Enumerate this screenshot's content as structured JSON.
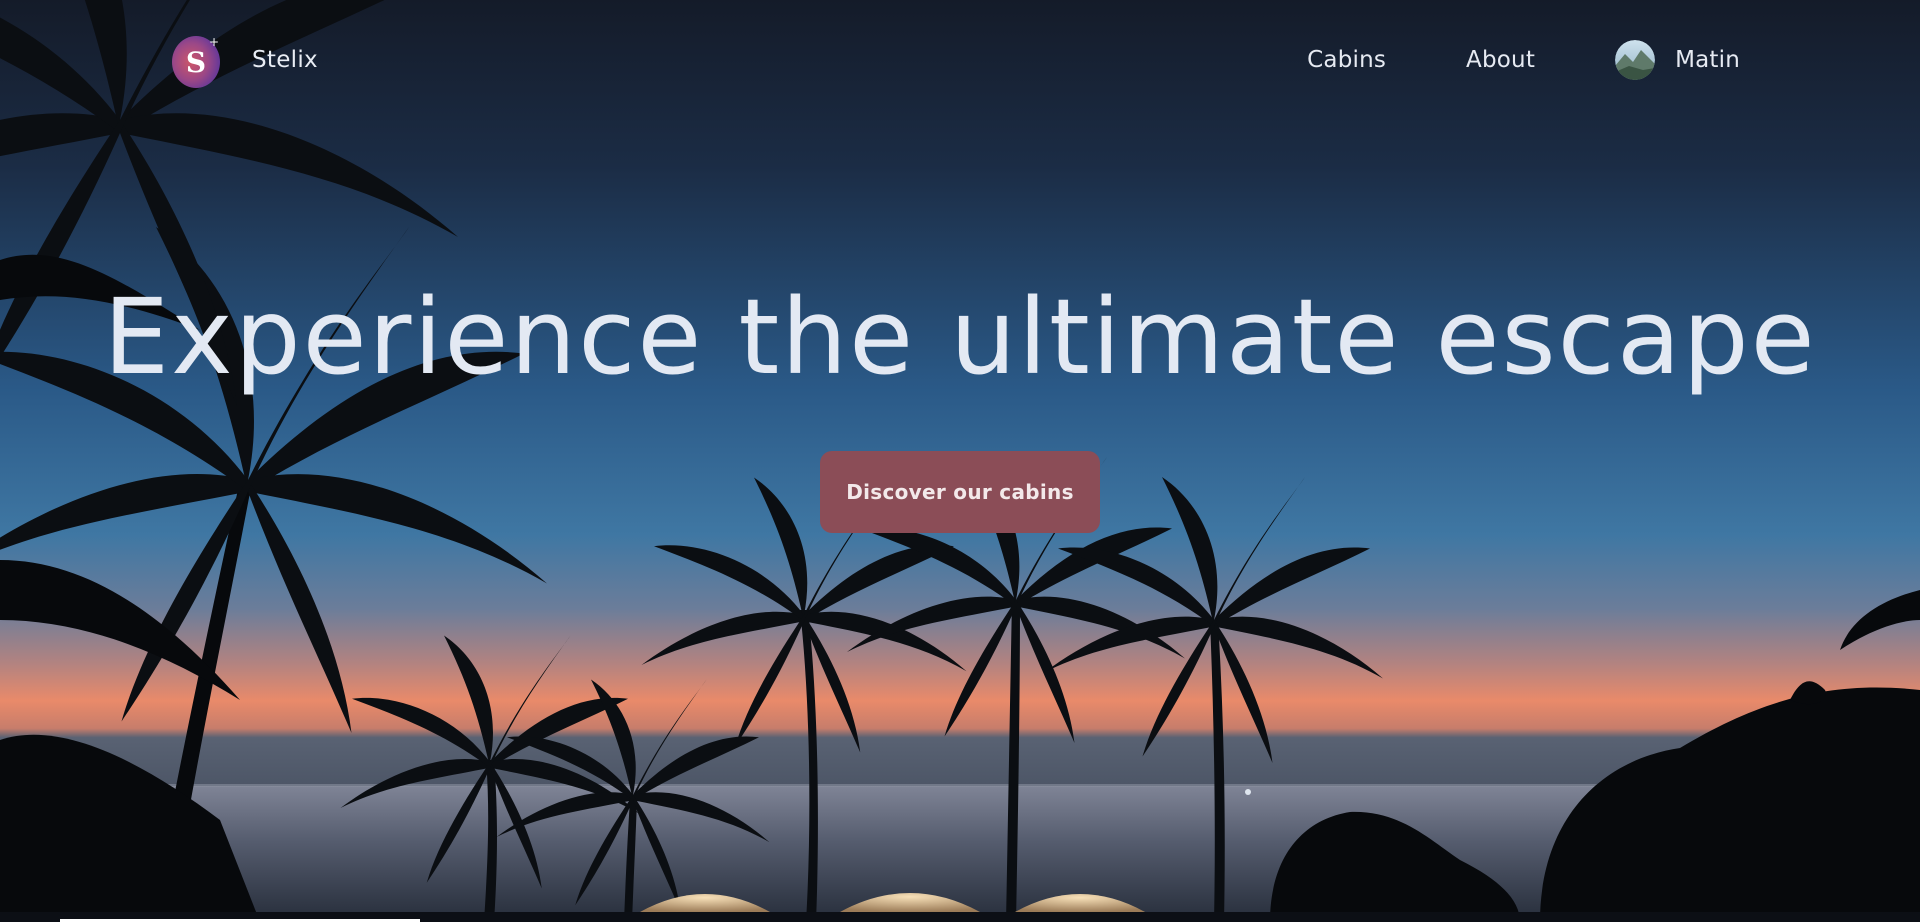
{
  "brand": {
    "name": "Stelix",
    "logo_letter": "S"
  },
  "nav": {
    "cabins": "Cabins",
    "about": "About",
    "profile_name": "Matin"
  },
  "hero": {
    "headline": "Experience the ultimate escape",
    "cta_label": "Discover our cabins"
  },
  "icons": {
    "logo": "stelix-logo-icon",
    "avatar": "user-avatar"
  },
  "colors": {
    "cta_background": "#8b4d57",
    "text": "#e3e9f3",
    "sky_top": "#131d2e",
    "sky_mid": "#2a5a86",
    "horizon": "#e98a6a"
  }
}
